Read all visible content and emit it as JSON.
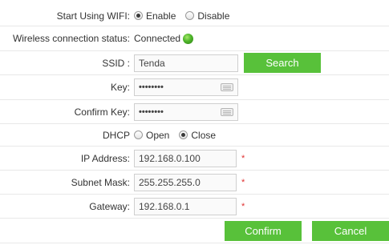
{
  "wifi": {
    "label": "Start Using WIFI:",
    "enable_label": "Enable",
    "disable_label": "Disable",
    "selected": "Enable"
  },
  "status": {
    "label": "Wireless connection status:",
    "value": "Connected",
    "indicator_color": "#4eb52a"
  },
  "ssid": {
    "label": "SSID :",
    "value": "Tenda",
    "search_label": "Search"
  },
  "key": {
    "label": "Key:",
    "value": "••••••••",
    "icon": "keyboard-icon"
  },
  "confirm_key": {
    "label": "Confirm Key:",
    "value": "••••••••",
    "icon": "keyboard-icon"
  },
  "dhcp": {
    "label": "DHCP",
    "open_label": "Open",
    "close_label": "Close",
    "selected": "Close"
  },
  "ip": {
    "label": "IP Address:",
    "value": "192.168.0.100",
    "required_mark": "*"
  },
  "subnet": {
    "label": "Subnet Mask:",
    "value": "255.255.255.0",
    "required_mark": "*"
  },
  "gateway": {
    "label": "Gateway:",
    "value": "192.168.0.1",
    "required_mark": "*"
  },
  "actions": {
    "confirm_label": "Confirm",
    "cancel_label": "Cancel"
  },
  "colors": {
    "button_green": "#58c13a",
    "required_red": "#e03030"
  }
}
